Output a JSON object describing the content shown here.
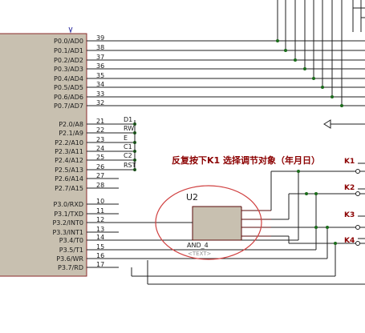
{
  "chip": {
    "ports_p0": [
      {
        "name": "P0.0/AD0",
        "pin": "39"
      },
      {
        "name": "P0.1/AD1",
        "pin": "38"
      },
      {
        "name": "P0.2/AD2",
        "pin": "37"
      },
      {
        "name": "P0.3/AD3",
        "pin": "36"
      },
      {
        "name": "P0.4/AD4",
        "pin": "35"
      },
      {
        "name": "P0.5/AD5",
        "pin": "34"
      },
      {
        "name": "P0.6/AD6",
        "pin": "33"
      },
      {
        "name": "P0.7/AD7",
        "pin": "32"
      }
    ],
    "ports_p2": [
      {
        "name": "P2.0/A8",
        "pin": "21",
        "net": "D1"
      },
      {
        "name": "P2.1/A9",
        "pin": "22",
        "net": "RW"
      },
      {
        "name": "P2.2/A10",
        "pin": "23",
        "net": "E"
      },
      {
        "name": "P2.3/A11",
        "pin": "24",
        "net": "C1"
      },
      {
        "name": "P2.4/A12",
        "pin": "25",
        "net": "C2"
      },
      {
        "name": "P2.5/A13",
        "pin": "26",
        "net": "RST"
      },
      {
        "name": "P2.6/A14",
        "pin": "27",
        "net": ""
      },
      {
        "name": "P2.7/A15",
        "pin": "28",
        "net": ""
      }
    ],
    "ports_p3": [
      {
        "name": "P3.0/RXD",
        "pin": "10"
      },
      {
        "name": "P3.1/TXD",
        "pin": "11"
      },
      {
        "name": "P3.2/INT0",
        "pin": "12"
      },
      {
        "name": "P3.3/INT1",
        "pin": "13"
      },
      {
        "name": "P3.4/T0",
        "pin": "14"
      },
      {
        "name": "P3.5/T1",
        "pin": "15"
      },
      {
        "name": "P3.6/WR",
        "pin": "16"
      },
      {
        "name": "P3.7/RD",
        "pin": "17"
      }
    ]
  },
  "gate": {
    "ref": "U2",
    "type": "AND_4",
    "text": "<TEXT>"
  },
  "annotation": "反复按下K1  选择调节对象（年月日）",
  "keys": [
    "K1",
    "K2",
    "K3",
    "K4"
  ],
  "colors": {
    "chip_fill": "#c8c0b0",
    "gate_fill": "#c8c0b0",
    "wire": "#1f1f1f",
    "dot": "#1a6b1a",
    "annotation": "#8b0000",
    "ellipse": "#d04040",
    "key_label": "#8b0000"
  }
}
